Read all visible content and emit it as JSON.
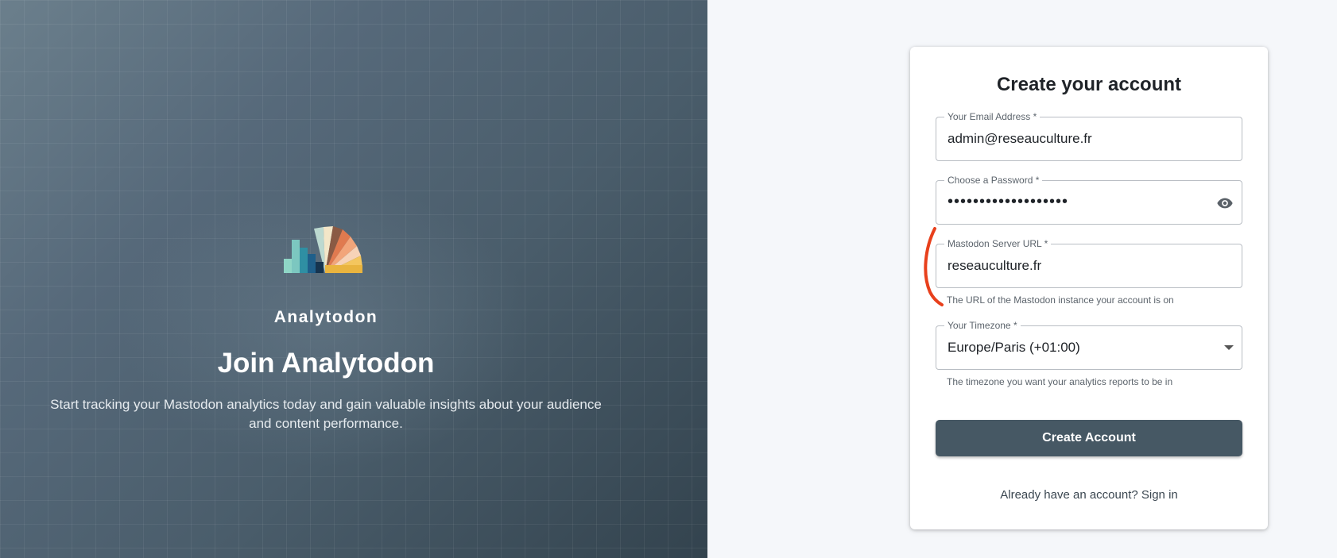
{
  "hero": {
    "brand": "Analytodon",
    "title": "Join Analytodon",
    "subtitle": "Start tracking your Mastodon analytics today and gain valuable insights about your audience and content performance."
  },
  "form": {
    "title": "Create your account",
    "email": {
      "label": "Your Email Address *",
      "value": "admin@reseauculture.fr"
    },
    "password": {
      "label": "Choose a Password *",
      "value": "•••••••••••••••••••",
      "toggle_icon": "eye-icon"
    },
    "server": {
      "label": "Mastodon Server URL *",
      "value": "reseauculture.fr",
      "helper": "The URL of the Mastodon instance your account is on"
    },
    "timezone": {
      "label": "Your Timezone *",
      "value": "Europe/Paris (+01:00)",
      "helper": "The timezone you want your analytics reports to be in",
      "dropdown_icon": "chevron-down-icon"
    },
    "submit_label": "Create Account",
    "signin_prompt": "Already have an account?",
    "signin_link": "Sign in"
  },
  "colors": {
    "primary_button": "#465864",
    "annotation_stroke": "#e8401c"
  }
}
